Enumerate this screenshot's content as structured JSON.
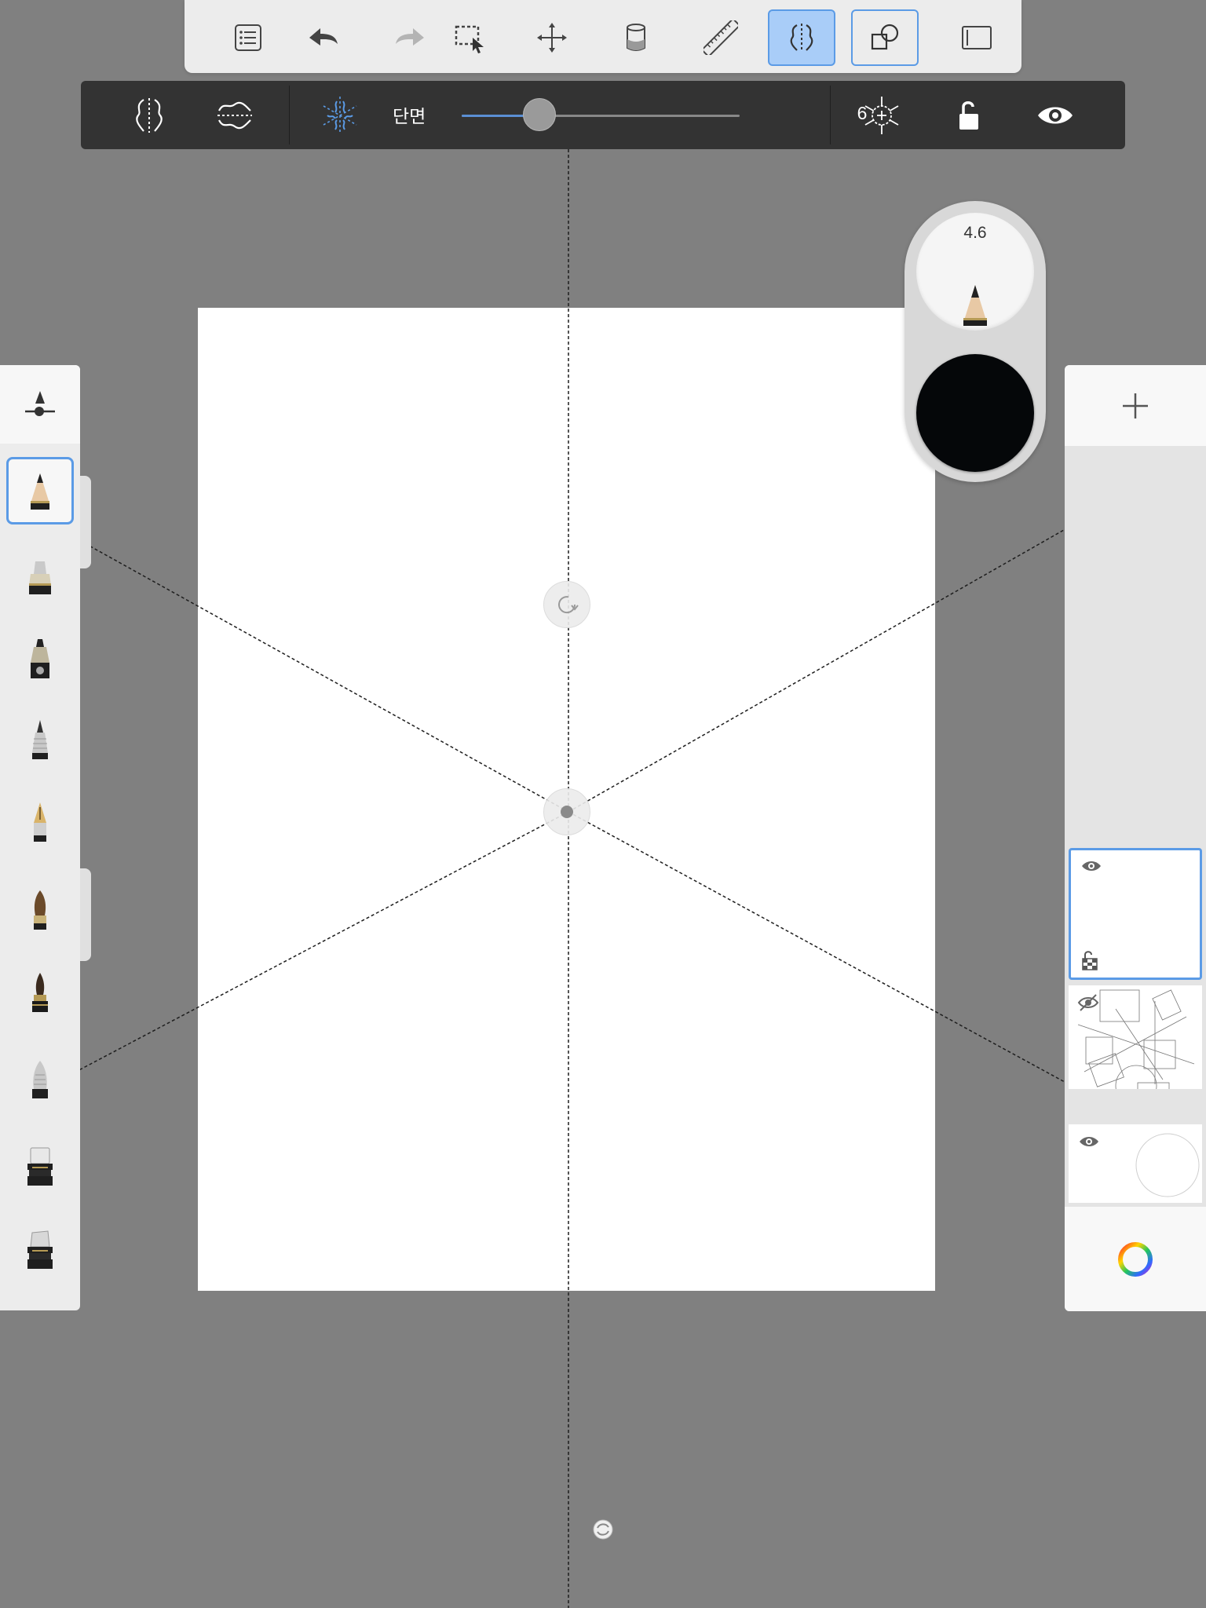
{
  "toolbar": {
    "buttons": [
      {
        "name": "layer-menu",
        "icon": "list-icon",
        "state": "normal"
      },
      {
        "name": "undo",
        "icon": "undo-arrow-icon",
        "state": "normal"
      },
      {
        "name": "redo",
        "icon": "redo-arrow-icon",
        "state": "disabled"
      },
      {
        "name": "selection",
        "icon": "marquee-select-icon",
        "state": "normal"
      },
      {
        "name": "transform",
        "icon": "move-arrows-icon",
        "state": "normal"
      },
      {
        "name": "fill",
        "icon": "paint-bucket-icon",
        "state": "normal"
      },
      {
        "name": "ruler",
        "icon": "ruler-icon",
        "state": "normal"
      },
      {
        "name": "symmetry",
        "icon": "symmetry-icon",
        "state": "active"
      },
      {
        "name": "predictive-stroke",
        "icon": "shapes-icon",
        "state": "outlined"
      },
      {
        "name": "fullscreen",
        "icon": "canvas-frame-icon",
        "state": "normal"
      }
    ]
  },
  "symmetry_bar": {
    "sectors_label": "단면",
    "sectors_value": "6",
    "sectors_fraction": 0.28,
    "modes": [
      "vertical-symmetry-icon",
      "horizontal-symmetry-icon",
      "radial-symmetry-icon"
    ],
    "actions": [
      "radial-center-icon",
      "unlock-icon",
      "eye-icon"
    ]
  },
  "brushes": [
    {
      "name": "pencil",
      "selected": true
    },
    {
      "name": "marker",
      "selected": false
    },
    {
      "name": "felt-pen",
      "selected": false
    },
    {
      "name": "ballpoint",
      "selected": false
    },
    {
      "name": "fountain-pen",
      "selected": false
    },
    {
      "name": "paint-brush",
      "selected": false
    },
    {
      "name": "ink-brush",
      "selected": false
    },
    {
      "name": "airbrush",
      "selected": false
    },
    {
      "name": "eraser-hard",
      "selected": false
    },
    {
      "name": "eraser-soft",
      "selected": false
    }
  ],
  "puck": {
    "size_value": "4.6",
    "color": "#050709"
  },
  "layers": [
    {
      "name": "layer-1",
      "visible": true,
      "selected": true
    },
    {
      "name": "layer-2",
      "visible": false,
      "selected": false
    },
    {
      "name": "layer-3",
      "visible": true,
      "selected": false
    }
  ],
  "colors": {
    "accent": "#5b9be6",
    "canvas_bg": "#808080",
    "paper": "#ffffff",
    "bar": "#333333"
  }
}
